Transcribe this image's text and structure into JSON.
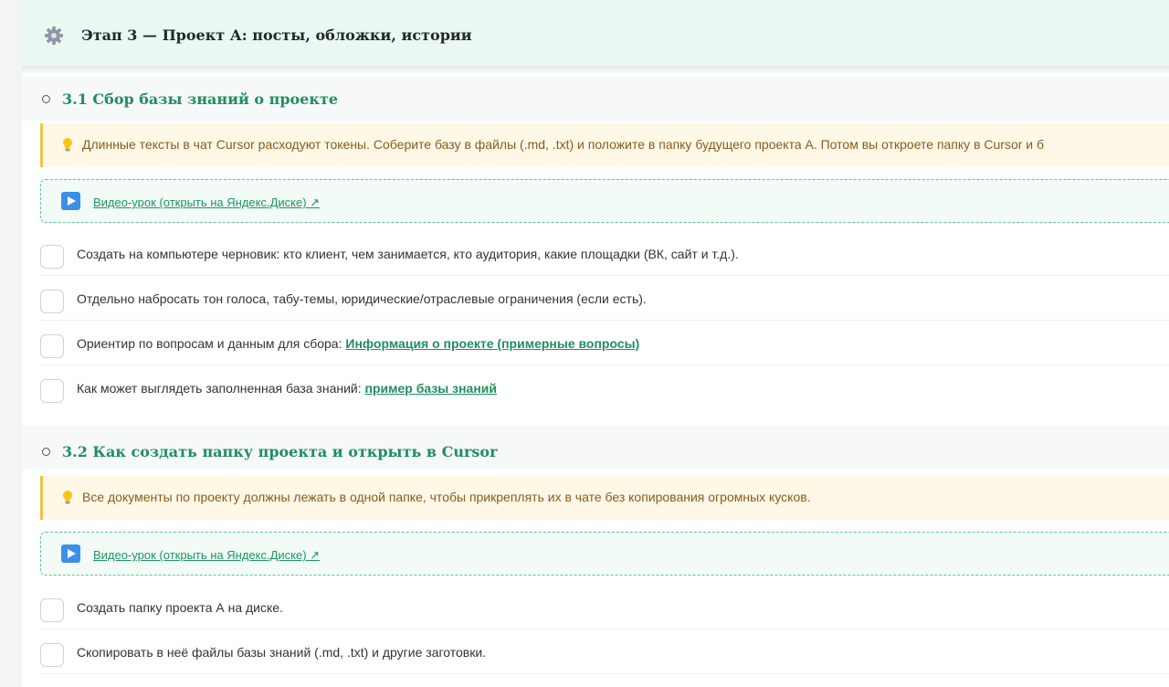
{
  "stage": {
    "title": "Этап 3 — Проект А: посты, обложки, истории",
    "icon": "gear-icon"
  },
  "colors": {
    "accent_green": "#1f8f5e",
    "header_bg": "#ebf8f1",
    "tip_bg": "#fff8e6",
    "tip_border": "#f2c247",
    "tip_text": "#8a5a1e",
    "video_border": "#61c493",
    "play_icon": "#3d8ee8"
  },
  "sections": [
    {
      "title": "3.1 Сбор базы знаний о проекте",
      "tip": "Длинные тексты в чат Cursor расходуют токены. Соберите базу в файлы (.md, .txt) и положите в папку будущего проекта А. Потом вы откроете папку в Cursor и б",
      "tip_icon": "lightbulb-icon",
      "video_label": "Видео-урок (открыть на Яндекс.Диске) ↗",
      "video_icon": "play-icon",
      "tasks": [
        {
          "text": "Создать на компьютере черновик: кто клиент, чем занимается, кто аудитория, какие площадки (ВК, сайт и т.д.).",
          "link": ""
        },
        {
          "text": "Отдельно набросать тон голоса, табу-темы, юридические/отраслевые ограничения (если есть).",
          "link": ""
        },
        {
          "text": "Ориентир по вопросам и данным для сбора: ",
          "link": "Информация о проекте (примерные вопросы)"
        },
        {
          "text": "Как может выглядеть заполненная база знаний: ",
          "link": "пример базы знаний"
        }
      ]
    },
    {
      "title": "3.2 Как создать папку проекта и открыть в Cursor",
      "tip": "Все документы по проекту должны лежать в одной папке, чтобы прикреплять их в чате без копирования огромных кусков.",
      "tip_icon": "lightbulb-icon",
      "video_label": "Видео-урок (открыть на Яндекс.Диске) ↗",
      "video_icon": "play-icon",
      "tasks": [
        {
          "text": "Создать папку проекта А на диске.",
          "link": ""
        },
        {
          "text": "Скопировать в неё файлы базы знаний (.md, .txt) и другие заготовки.",
          "link": ""
        }
      ]
    }
  ]
}
